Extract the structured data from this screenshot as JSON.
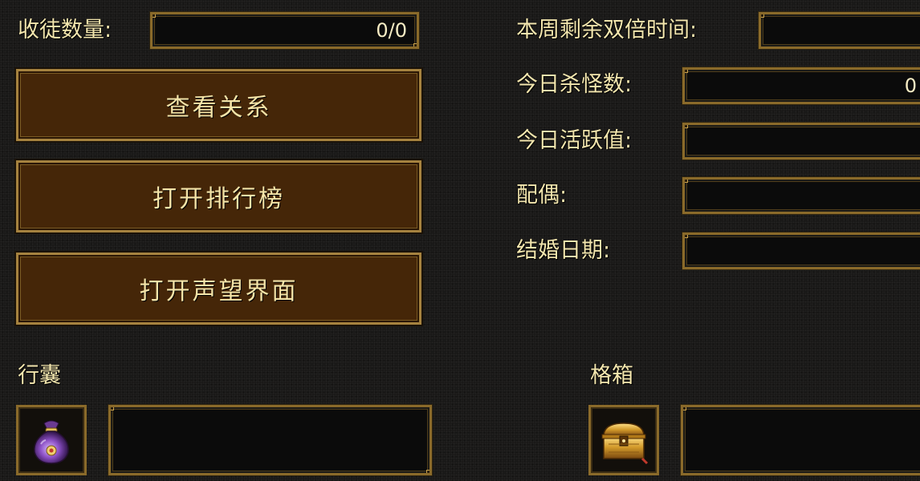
{
  "top_left": {
    "apprentice_label": "收徒数量:",
    "apprentice_value": "0/0"
  },
  "buttons": {
    "view_relations": "查看关系",
    "open_ranking": "打开排行榜",
    "open_reputation": "打开声望界面"
  },
  "stats": {
    "double_time_label": "本周剩余双倍时间:",
    "double_time_value": "",
    "kills_label": "今日杀怪数:",
    "kills_value": "0",
    "activity_label": "今日活跃值:",
    "activity_value": "",
    "spouse_label": "配偶:",
    "spouse_value": "",
    "wedding_label": "结婚日期:",
    "wedding_value": ""
  },
  "bag": {
    "title": "行囊",
    "icon": "bag-icon",
    "value": ""
  },
  "storage": {
    "title": "格箱",
    "icon": "chest-icon",
    "value": ""
  }
}
